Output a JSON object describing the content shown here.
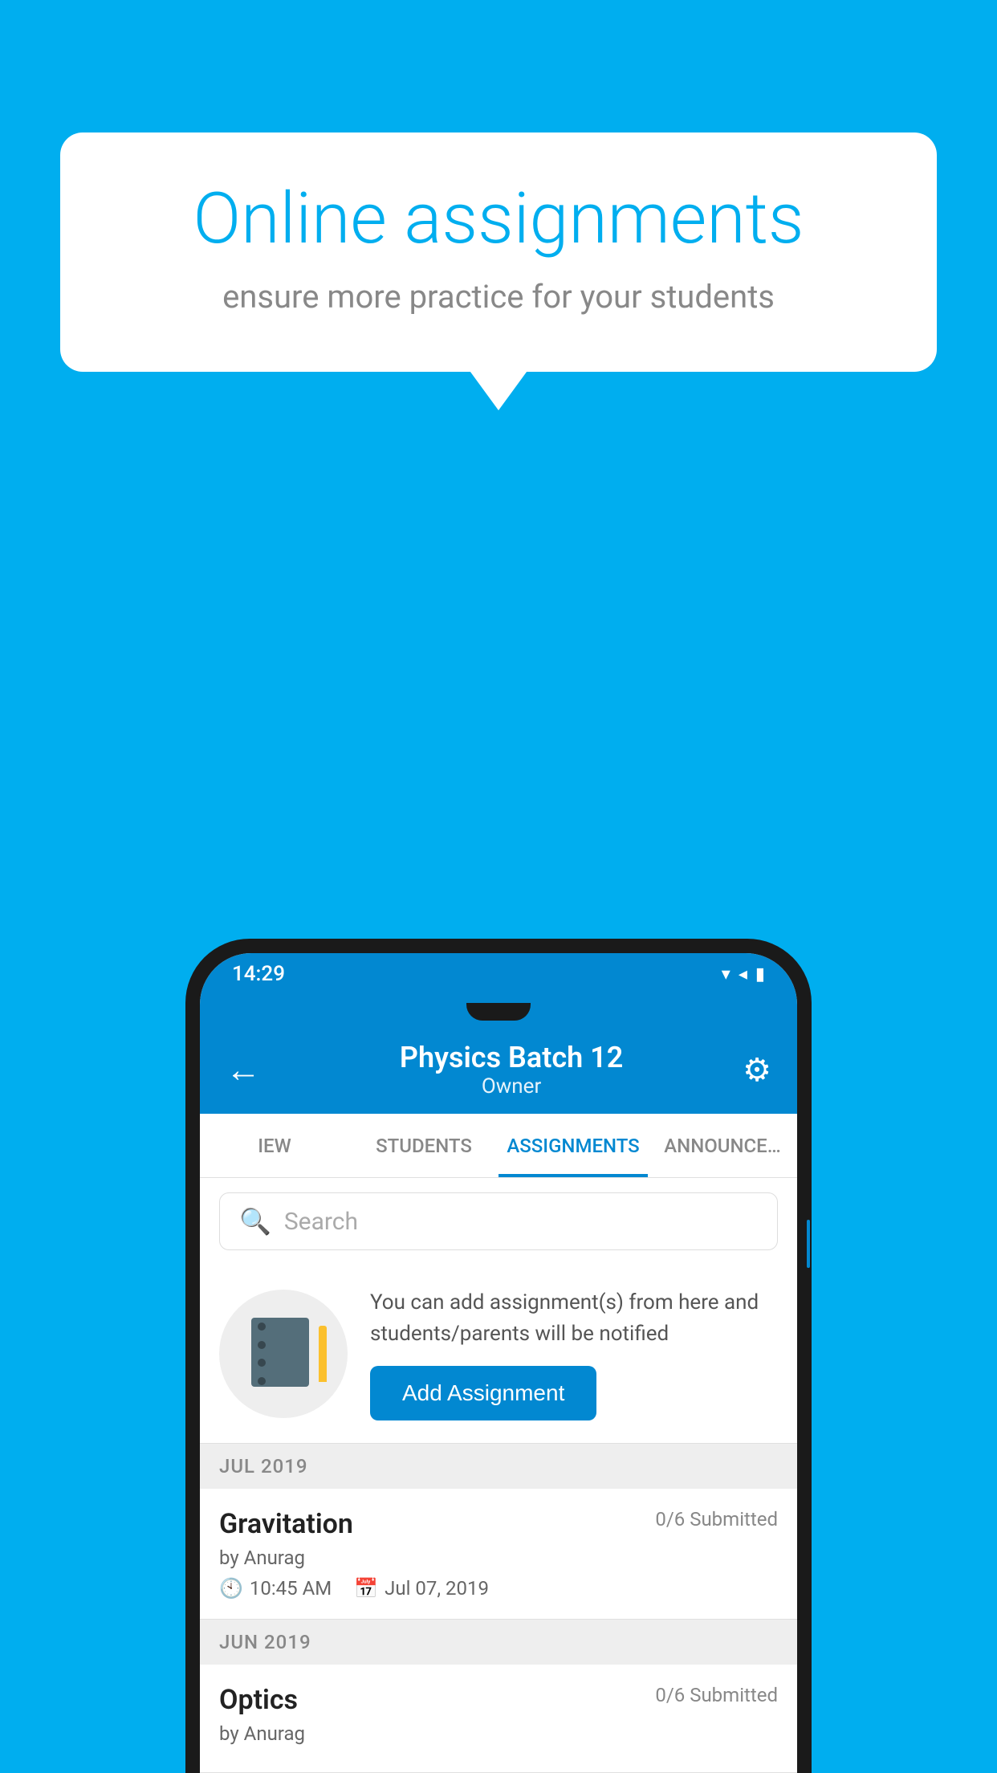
{
  "background_color": "#00AEEF",
  "bubble": {
    "title": "Online assignments",
    "subtitle": "ensure more practice for your students"
  },
  "status_bar": {
    "time": "14:29",
    "icons": "▾◂▮"
  },
  "app_bar": {
    "title": "Physics Batch 12",
    "subtitle": "Owner",
    "back_label": "←",
    "settings_label": "⚙"
  },
  "tabs": [
    {
      "label": "IEW",
      "active": false
    },
    {
      "label": "STUDENTS",
      "active": false
    },
    {
      "label": "ASSIGNMENTS",
      "active": true
    },
    {
      "label": "ANNOUNCEMENTS",
      "active": false
    }
  ],
  "search": {
    "placeholder": "Search"
  },
  "promo": {
    "description": "You can add assignment(s) from here and students/parents will be notified",
    "button_label": "Add Assignment"
  },
  "sections": [
    {
      "month": "JUL 2019",
      "assignments": [
        {
          "name": "Gravitation",
          "submitted": "0/6 Submitted",
          "by": "by Anurag",
          "time": "10:45 AM",
          "date": "Jul 07, 2019"
        }
      ]
    },
    {
      "month": "JUN 2019",
      "assignments": [
        {
          "name": "Optics",
          "submitted": "0/6 Submitted",
          "by": "by Anurag",
          "time": "",
          "date": ""
        }
      ]
    }
  ]
}
